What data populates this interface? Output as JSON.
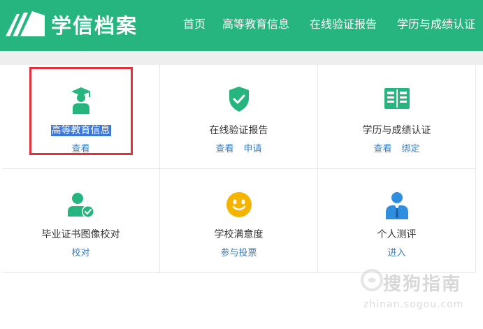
{
  "header": {
    "brand": "学信档案",
    "nav": [
      {
        "label": "首页"
      },
      {
        "label": "高等教育信息"
      },
      {
        "label": "在线验证报告"
      },
      {
        "label": "学历与成绩认证"
      }
    ]
  },
  "cards": [
    {
      "title": "高等教育信息",
      "actions": [
        "查看"
      ],
      "icon": "graduate-icon"
    },
    {
      "title": "在线验证报告",
      "actions": [
        "查看",
        "申请"
      ],
      "icon": "shield-check-icon"
    },
    {
      "title": "学历与成绩认证",
      "actions": [
        "查看",
        "绑定"
      ],
      "icon": "certificate-icon"
    },
    {
      "title": "毕业证书图像校对",
      "actions": [
        "校对"
      ],
      "icon": "person-check-icon"
    },
    {
      "title": "学校满意度",
      "actions": [
        "参与投票"
      ],
      "icon": "smiley-icon"
    },
    {
      "title": "个人测评",
      "actions": [
        "进入"
      ],
      "icon": "person-tie-icon"
    }
  ],
  "watermark": {
    "text": "搜狗指南",
    "url": "zhinan.sogou.com"
  },
  "colors": {
    "brand_green": "#27b57f",
    "link_blue": "#3a7ec2",
    "highlight_red": "#e0313d",
    "selection_blue": "#3c78d8"
  }
}
